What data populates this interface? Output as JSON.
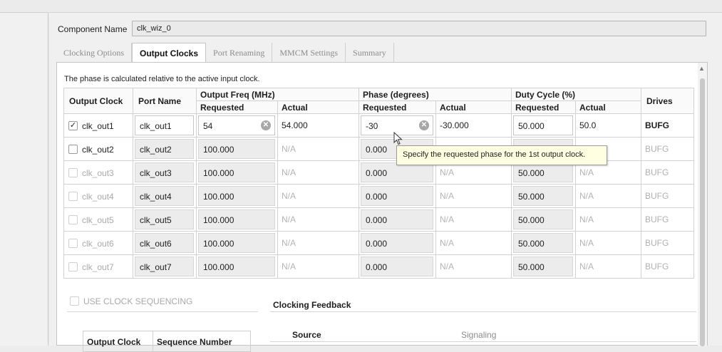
{
  "component": {
    "label": "Component Name",
    "value": "clk_wiz_0"
  },
  "tabs": [
    {
      "label": "Clocking Options",
      "active": false
    },
    {
      "label": "Output Clocks",
      "active": true
    },
    {
      "label": "Port Renaming",
      "active": false
    },
    {
      "label": "MMCM Settings",
      "active": false
    },
    {
      "label": "Summary",
      "active": false
    }
  ],
  "note": "The phase is calculated relative to the active input clock.",
  "table": {
    "headers": {
      "output_clock": "Output Clock",
      "port_name": "Port Name",
      "output_freq": "Output Freq (MHz)",
      "phase": "Phase (degrees)",
      "duty_cycle": "Duty Cycle (%)",
      "drives": "Drives",
      "requested": "Requested",
      "actual": "Actual"
    },
    "rows": [
      {
        "checked": true,
        "enabled": true,
        "clock": "clk_out1",
        "port": "clk_out1",
        "freq_req": "54",
        "freq_act": "54.000",
        "phase_req": "-30",
        "phase_act": "-30.000",
        "duty_req": "50.000",
        "duty_act": "50.0",
        "drives": "BUFG"
      },
      {
        "checked": false,
        "enabled": true,
        "clock": "clk_out2",
        "port": "clk_out2",
        "freq_req": "100.000",
        "freq_act": "N/A",
        "phase_req": "0.000",
        "phase_act": "",
        "duty_req": "",
        "duty_act": "",
        "drives": "BUFG"
      },
      {
        "checked": false,
        "enabled": false,
        "clock": "clk_out3",
        "port": "clk_out3",
        "freq_req": "100.000",
        "freq_act": "N/A",
        "phase_req": "0.000",
        "phase_act": "N/A",
        "duty_req": "50.000",
        "duty_act": "N/A",
        "drives": "BUFG"
      },
      {
        "checked": false,
        "enabled": false,
        "clock": "clk_out4",
        "port": "clk_out4",
        "freq_req": "100.000",
        "freq_act": "N/A",
        "phase_req": "0.000",
        "phase_act": "N/A",
        "duty_req": "50.000",
        "duty_act": "N/A",
        "drives": "BUFG"
      },
      {
        "checked": false,
        "enabled": false,
        "clock": "clk_out5",
        "port": "clk_out5",
        "freq_req": "100.000",
        "freq_act": "N/A",
        "phase_req": "0.000",
        "phase_act": "N/A",
        "duty_req": "50.000",
        "duty_act": "N/A",
        "drives": "BUFG"
      },
      {
        "checked": false,
        "enabled": false,
        "clock": "clk_out6",
        "port": "clk_out6",
        "freq_req": "100.000",
        "freq_act": "N/A",
        "phase_req": "0.000",
        "phase_act": "N/A",
        "duty_req": "50.000",
        "duty_act": "N/A",
        "drives": "BUFG"
      },
      {
        "checked": false,
        "enabled": false,
        "clock": "clk_out7",
        "port": "clk_out7",
        "freq_req": "100.000",
        "freq_act": "N/A",
        "phase_req": "0.000",
        "phase_act": "N/A",
        "duty_req": "50.000",
        "duty_act": "N/A",
        "drives": "BUFG"
      }
    ]
  },
  "tooltip": "Specify the requested phase for the 1st output clock.",
  "sequencing": {
    "label": "USE CLOCK SEQUENCING",
    "col_output_clock": "Output Clock",
    "col_sequence_number": "Sequence Number"
  },
  "feedback": {
    "title": "Clocking Feedback",
    "source_label": "Source",
    "signaling_label": "Signaling"
  }
}
